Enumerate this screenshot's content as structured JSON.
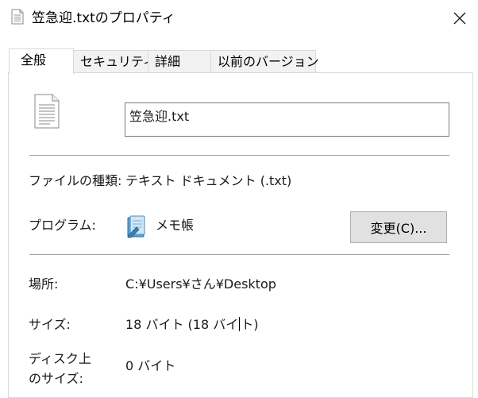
{
  "window": {
    "title": "笠急迎.txtのプロパティ",
    "close_symbol": "✕"
  },
  "tabs": [
    {
      "label": "全般",
      "active": true
    },
    {
      "label": "セキュリティ",
      "active": false
    },
    {
      "label": "詳細",
      "active": false
    },
    {
      "label": "以前のバージョン",
      "active": false
    }
  ],
  "general": {
    "filename": "笠急迎.txt",
    "file_type_label": "ファイルの種類:",
    "file_type_value": "テキスト ドキュメント (.txt)",
    "program_label": "プログラム:",
    "program_value": "メモ帳",
    "change_button": "変更(C)...",
    "location_label": "場所:",
    "location_value": "C:¥Users¥さん¥Desktop",
    "size_label": "サイズ:",
    "size_value_before_caret": "18 バイト (18 バイ",
    "size_value_after_caret": "ト)",
    "disk_size_label_line1": "ディスク上",
    "disk_size_label_line2": "のサイズ:",
    "disk_size_value": "0 バイト"
  },
  "icons": {
    "title": "document-icon",
    "file": "text-file-icon",
    "program": "notepad-icon",
    "close": "close-icon"
  }
}
